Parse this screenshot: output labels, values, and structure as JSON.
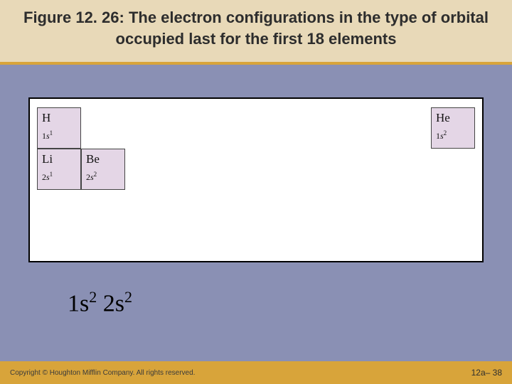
{
  "title": "Figure 12. 26:  The electron configurations in the type of orbital occupied last for the first 18 elements",
  "cells": {
    "h": {
      "symbol": "H",
      "config_n": "1",
      "config_l": "s",
      "config_sup": "1"
    },
    "he": {
      "symbol": "He",
      "config_n": "1",
      "config_l": "s",
      "config_sup": "2"
    },
    "li": {
      "symbol": "Li",
      "config_n": "2",
      "config_l": "s",
      "config_sup": "1"
    },
    "be": {
      "symbol": "Be",
      "config_n": "2",
      "config_l": "s",
      "config_sup": "2"
    }
  },
  "config_line": {
    "part1_n": "1",
    "part1_l": "s",
    "part1_sup": "2",
    "part2_n": "2",
    "part2_l": "s",
    "part2_sup": "2"
  },
  "footer": {
    "copyright": "Copyright © Houghton Mifflin Company. All rights reserved.",
    "page": "12a– 38"
  }
}
